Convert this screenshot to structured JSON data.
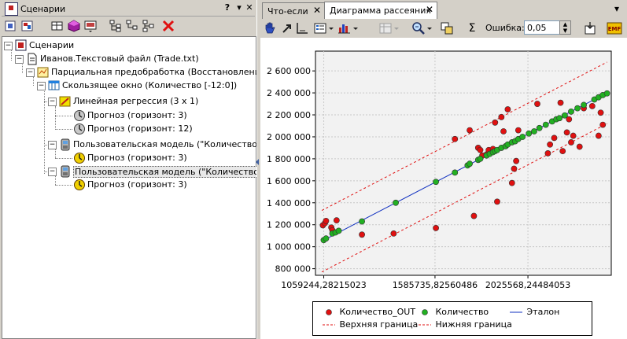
{
  "left_panel": {
    "title": "Сценарии",
    "controls": {
      "help": "?",
      "menu": "▾",
      "close": "✕"
    },
    "toolbar": [
      "new-scenario-icon",
      "open-icon",
      "cube-icon",
      "monitor-icon",
      "tree-add-icon",
      "tree-branch-icon",
      "tree-sort-icon",
      "delete-icon"
    ],
    "tree": [
      {
        "label": "Сценарии",
        "level": 0,
        "expanded": true,
        "icon": "scenario-icon"
      },
      {
        "label": "Иванов.Текстовый файл (Trade.txt)",
        "level": 1,
        "expanded": true,
        "icon": "text-file-icon"
      },
      {
        "label": "Парциальная предобработка (Восстановление, Ан",
        "level": 2,
        "expanded": true,
        "icon": "preprocess-icon"
      },
      {
        "label": "Скользящее окно (Количество [-12:0])",
        "level": 3,
        "expanded": true,
        "icon": "window-icon"
      },
      {
        "label": "Линейная регрессия (3 x 1)",
        "level": 4,
        "expanded": true,
        "icon": "regression-icon"
      },
      {
        "label": "Прогноз (горизонт: 3)",
        "level": 5,
        "icon": "forecast-icon"
      },
      {
        "label": "Прогноз (горизонт: 12)",
        "level": 5,
        "icon": "forecast-icon"
      },
      {
        "label": "Пользовательская модель (\"Количество\")",
        "level": 4,
        "expanded": true,
        "icon": "user-model-icon"
      },
      {
        "label": "Прогноз (горизонт: 3)",
        "level": 5,
        "icon": "forecast-active-icon"
      },
      {
        "label": "Пользовательская модель (\"Количество\")",
        "level": 4,
        "expanded": true,
        "selected": true,
        "icon": "user-model-icon"
      },
      {
        "label": "Прогноз (горизонт: 3)",
        "level": 5,
        "icon": "forecast-active-icon"
      }
    ]
  },
  "right_panel": {
    "tabs": [
      {
        "label": "Что-если",
        "close": "✕"
      },
      {
        "label": "Диаграмма рассеяния",
        "close": "✕",
        "active": true
      }
    ],
    "tab_arrow": "▾",
    "toolbar": {
      "error_label": "Ошибка:",
      "error_value": "0,05",
      "sigma": "Σ",
      "emf": "EMF"
    }
  },
  "chart_data": {
    "type": "scatter",
    "title": "",
    "xlabel": "",
    "ylabel": "",
    "xlim": [
      1020000,
      2420000
    ],
    "ylim": [
      740000,
      2780000
    ],
    "x_ticks": [
      "1059244,28215023",
      "1585735,82560486",
      "2025568,24484053"
    ],
    "x_tick_values": [
      1059244.28,
      1585735.83,
      2025568.24
    ],
    "y_ticks": [
      "800 000",
      "1 000 000",
      "1 200 000",
      "1 400 000",
      "1 600 000",
      "1 800 000",
      "2 000 000",
      "2 200 000",
      "2 400 000",
      "2 600 000"
    ],
    "y_tick_values": [
      800000,
      1000000,
      1200000,
      1400000,
      1600000,
      1800000,
      2000000,
      2200000,
      2400000,
      2600000
    ],
    "grid": true,
    "series": [
      {
        "name": "Количество_OUT",
        "color": "#e01010",
        "marker": "circle",
        "points": [
          [
            1055000,
            1195000
          ],
          [
            1065000,
            1215000
          ],
          [
            1070000,
            1235000
          ],
          [
            1095000,
            1175000
          ],
          [
            1100000,
            1150000
          ],
          [
            1120000,
            1240000
          ],
          [
            1240000,
            1110000
          ],
          [
            1390000,
            1120000
          ],
          [
            1590000,
            1170000
          ],
          [
            1680000,
            1980000
          ],
          [
            1750000,
            2060000
          ],
          [
            1770000,
            1280000
          ],
          [
            1790000,
            1900000
          ],
          [
            1800000,
            1880000
          ],
          [
            1810000,
            1830000
          ],
          [
            1830000,
            1840000
          ],
          [
            1840000,
            1880000
          ],
          [
            1860000,
            1890000
          ],
          [
            1870000,
            2130000
          ],
          [
            1880000,
            1410000
          ],
          [
            1900000,
            2180000
          ],
          [
            1910000,
            2050000
          ],
          [
            1930000,
            2250000
          ],
          [
            1950000,
            1580000
          ],
          [
            1960000,
            1710000
          ],
          [
            1970000,
            1780000
          ],
          [
            1980000,
            2060000
          ],
          [
            2070000,
            2300000
          ],
          [
            2120000,
            1850000
          ],
          [
            2130000,
            1930000
          ],
          [
            2150000,
            1990000
          ],
          [
            2180000,
            2310000
          ],
          [
            2190000,
            1870000
          ],
          [
            2210000,
            2040000
          ],
          [
            2220000,
            2160000
          ],
          [
            2230000,
            1950000
          ],
          [
            2240000,
            2010000
          ],
          [
            2270000,
            1910000
          ],
          [
            2290000,
            2260000
          ],
          [
            2330000,
            2280000
          ],
          [
            2360000,
            2010000
          ],
          [
            2370000,
            2220000
          ],
          [
            2380000,
            2110000
          ]
        ]
      },
      {
        "name": "Количество",
        "color": "#22b022",
        "marker": "circle",
        "points": [
          [
            1059000,
            1060000
          ],
          [
            1070000,
            1075000
          ],
          [
            1100000,
            1120000
          ],
          [
            1115000,
            1130000
          ],
          [
            1130000,
            1145000
          ],
          [
            1240000,
            1230000
          ],
          [
            1400000,
            1400000
          ],
          [
            1590000,
            1590000
          ],
          [
            1680000,
            1675000
          ],
          [
            1740000,
            1740000
          ],
          [
            1750000,
            1755000
          ],
          [
            1790000,
            1790000
          ],
          [
            1800000,
            1800000
          ],
          [
            1830000,
            1830000
          ],
          [
            1845000,
            1845000
          ],
          [
            1860000,
            1860000
          ],
          [
            1870000,
            1870000
          ],
          [
            1880000,
            1880000
          ],
          [
            1900000,
            1900000
          ],
          [
            1920000,
            1915000
          ],
          [
            1930000,
            1930000
          ],
          [
            1950000,
            1950000
          ],
          [
            1965000,
            1960000
          ],
          [
            1980000,
            1980000
          ],
          [
            2000000,
            2000000
          ],
          [
            2030000,
            2030000
          ],
          [
            2055000,
            2050000
          ],
          [
            2080000,
            2080000
          ],
          [
            2110000,
            2110000
          ],
          [
            2140000,
            2140000
          ],
          [
            2160000,
            2160000
          ],
          [
            2175000,
            2170000
          ],
          [
            2200000,
            2195000
          ],
          [
            2230000,
            2230000
          ],
          [
            2260000,
            2260000
          ],
          [
            2290000,
            2290000
          ],
          [
            2340000,
            2340000
          ],
          [
            2360000,
            2360000
          ],
          [
            2380000,
            2380000
          ],
          [
            2400000,
            2395000
          ]
        ]
      },
      {
        "name": "Эталон",
        "color": "#1030c0",
        "line": "solid",
        "points": [
          [
            1050000,
            1050000
          ],
          [
            2400000,
            2400000
          ]
        ]
      },
      {
        "name": "Верхняя граница",
        "color": "#e01010",
        "line": "dashed",
        "points": [
          [
            1050000,
            1330000
          ],
          [
            2400000,
            2680000
          ]
        ]
      },
      {
        "name": "Нижняя граница",
        "color": "#e01010",
        "line": "dashed",
        "points": [
          [
            1050000,
            770000
          ],
          [
            2400000,
            2120000
          ]
        ]
      }
    ],
    "legend": {
      "placement": "bottom",
      "entries": [
        {
          "label": "Количество_OUT",
          "kind": "dot",
          "color": "#e01010"
        },
        {
          "label": "Количество",
          "kind": "dot",
          "color": "#22b022"
        },
        {
          "label": "Эталон",
          "kind": "line",
          "color": "#1030c0"
        },
        {
          "label": "Верхняя граница",
          "kind": "dash",
          "color": "#e01010"
        },
        {
          "label": "Нижняя граница",
          "kind": "dash",
          "color": "#e01010"
        }
      ]
    }
  }
}
